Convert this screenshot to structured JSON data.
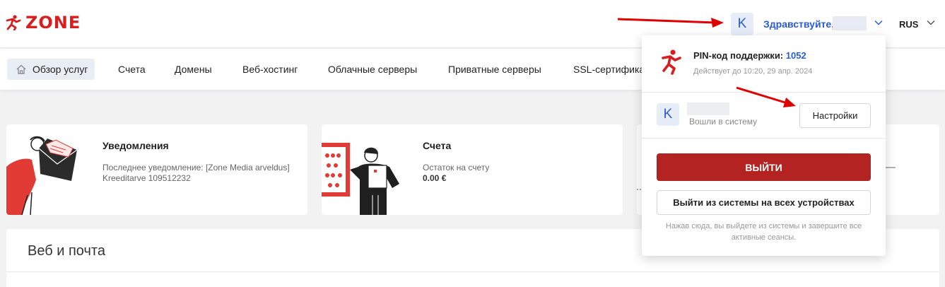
{
  "brand": {
    "logo_text": "ZONE",
    "logo_icon": "zone-runner-icon"
  },
  "header": {
    "avatar_letter": "K",
    "greeting": "Здравствуйте,",
    "language": "RUS"
  },
  "nav": {
    "items": [
      {
        "label": "Обзор услуг",
        "icon": "home-icon",
        "active": true
      },
      {
        "label": "Счета"
      },
      {
        "label": "Домены"
      },
      {
        "label": "Веб-хостинг"
      },
      {
        "label": "Облачные серверы"
      },
      {
        "label": "Приватные серверы"
      },
      {
        "label": "SSL-сертифика"
      }
    ]
  },
  "cards": {
    "notifications": {
      "title": "Уведомления",
      "line1": "Последнее уведомление: [Zone Media arveldus]",
      "line2": "Kreeditarve 109512232"
    },
    "invoices": {
      "title": "Счета",
      "subtitle": "Остаток на счету",
      "balance": "0.00 €"
    }
  },
  "section": {
    "title": "Веб и почта"
  },
  "dropdown": {
    "pin_label": "PIN-код поддержки:",
    "pin_value": "1052",
    "valid_until": "Действует до 10:20, 29 апр. 2024",
    "avatar_letter": "K",
    "logged_in": "Вошли в систему",
    "settings_label": "Настройки",
    "logout_label": "ВЫЙТИ",
    "logout_all_label": "Выйти из системы на всех устройствах",
    "hint": "Нажав сюда, вы выйдете из системы и завершите все активные сеансы."
  },
  "colors": {
    "brand_red": "#d81e1e",
    "logout_red": "#b22321",
    "link_blue": "#2a5bd7",
    "page_bg": "#f2f2f3"
  }
}
